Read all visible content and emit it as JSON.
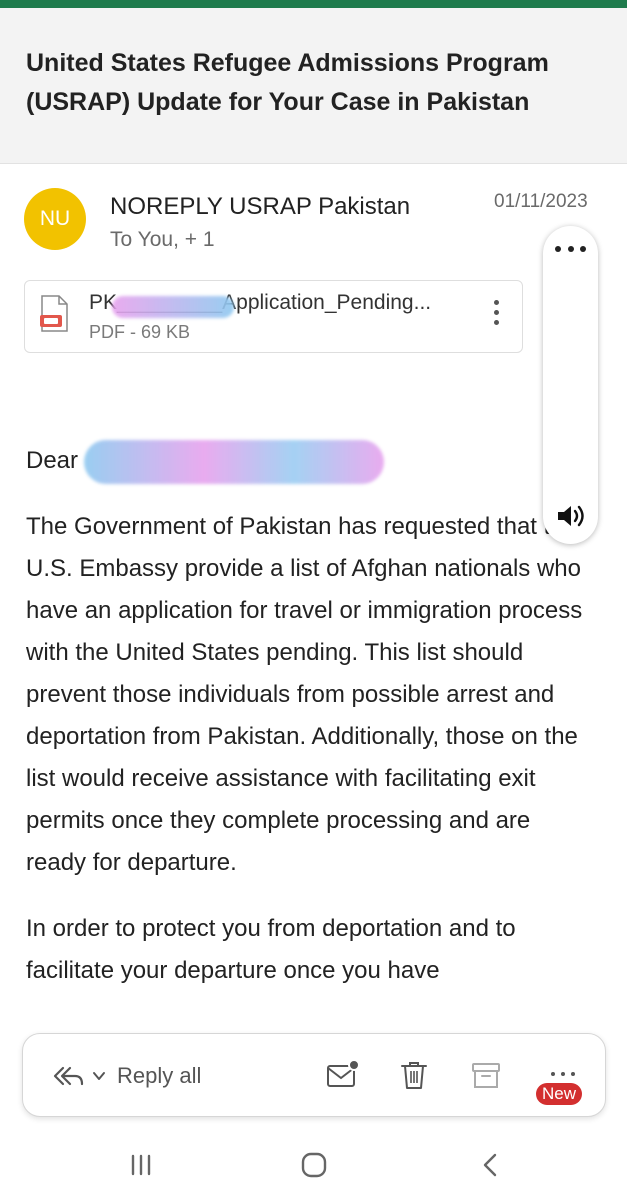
{
  "email": {
    "subject": "United States Refugee Admissions Program (USRAP) Update for Your Case in Pakistan",
    "avatar_initials": "NU",
    "sender": "NOREPLY USRAP Pakistan",
    "recipients": "To You, + 1",
    "date": "01/11/2023"
  },
  "attachment": {
    "name": "PK_________Application_Pending...",
    "meta": "PDF - 69 KB",
    "icon": "pdf-icon"
  },
  "body": {
    "greeting": "Dear",
    "paragraphs": [
      "The Government of Pakistan has requested that the U.S. Embassy provide a list of Afghan nationals who have an application for travel or immigration process with the United States pending. This list should prevent those individuals from possible arrest and deportation from Pakistan. Additionally, those on the list would receive assistance with facilitating exit permits once they complete processing and are ready for departure.",
      "In order to protect you from deportation and to facilitate your departure once you have"
    ]
  },
  "actions": {
    "reply_all": "Reply all",
    "new_badge": "New"
  },
  "colors": {
    "top_accent": "#1e7b4c",
    "avatar": "#f2c200",
    "badge": "#d32f2f"
  }
}
